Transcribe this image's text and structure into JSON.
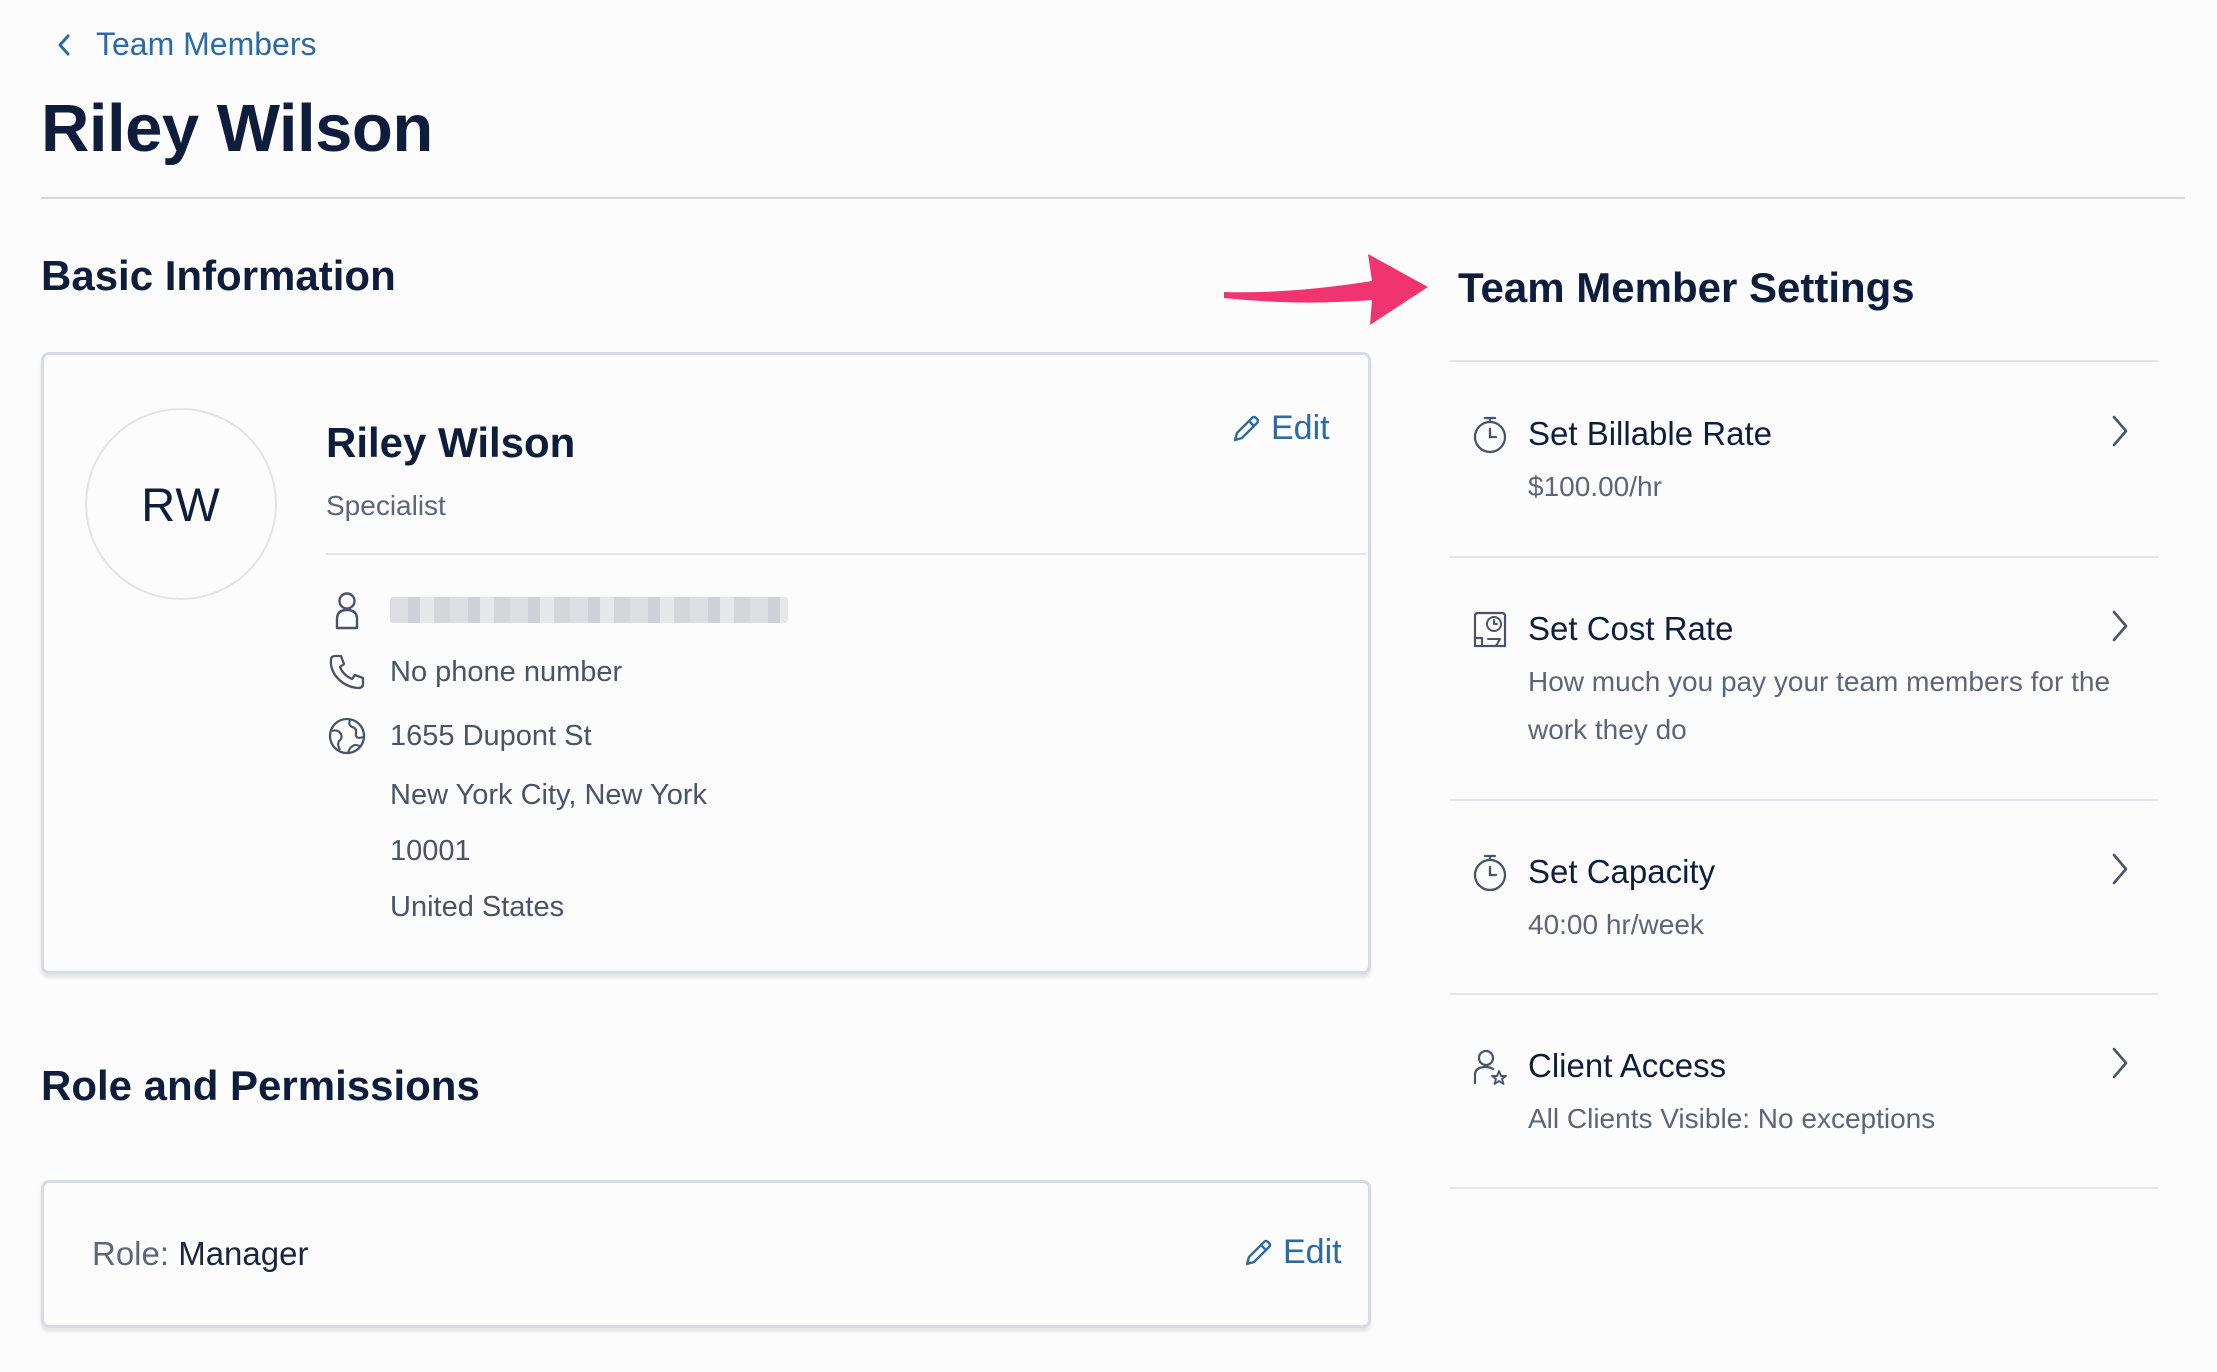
{
  "breadcrumb": {
    "label": "Team Members"
  },
  "page": {
    "title": "Riley Wilson"
  },
  "basic_info": {
    "heading": "Basic Information",
    "avatar_initials": "RW",
    "name": "Riley Wilson",
    "role": "Specialist",
    "edit_label": "Edit",
    "phone": "No phone number",
    "address": {
      "street": "1655 Dupont St",
      "city_state": "New York City, New York",
      "zip": "10001",
      "country": "United States"
    }
  },
  "role_permissions": {
    "heading": "Role and Permissions",
    "role_prefix": "Role: ",
    "role_value": "Manager",
    "edit_label": "Edit"
  },
  "settings": {
    "heading": "Team Member Settings",
    "items": [
      {
        "title": "Set Billable Rate",
        "subtitle": "$100.00/hr",
        "icon": "stopwatch-icon"
      },
      {
        "title": "Set Cost Rate",
        "subtitle": "How much you pay your team members for the work they do",
        "icon": "cost-rate-icon"
      },
      {
        "title": "Set Capacity",
        "subtitle": "40:00 hr/week",
        "icon": "stopwatch-icon"
      },
      {
        "title": "Client Access",
        "subtitle": "All Clients Visible: No exceptions",
        "icon": "user-star-icon"
      }
    ]
  },
  "colors": {
    "link": "#2a6ba6",
    "heading": "#0f1d3c",
    "annotation_arrow": "#f0346f"
  }
}
